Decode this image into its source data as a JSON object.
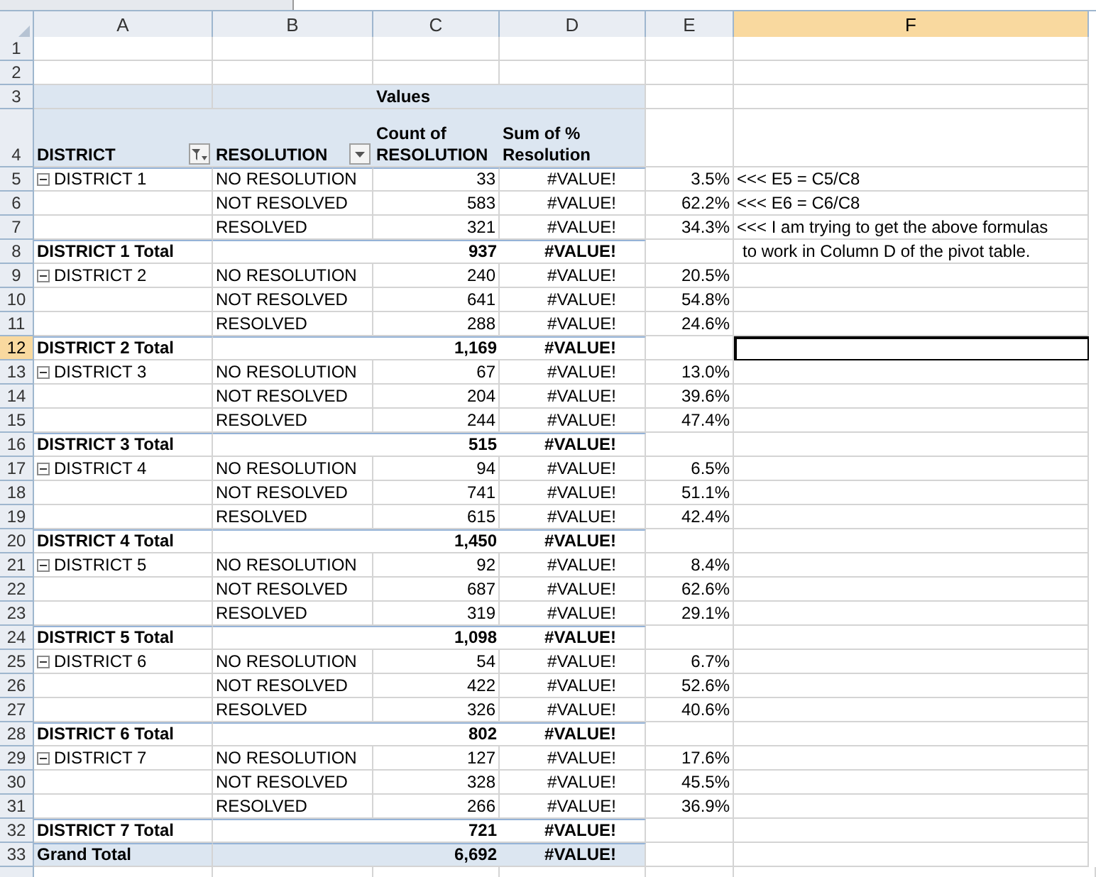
{
  "columns": [
    {
      "label": "A",
      "selected": false
    },
    {
      "label": "B",
      "selected": false
    },
    {
      "label": "C",
      "selected": false
    },
    {
      "label": "D",
      "selected": false
    },
    {
      "label": "E",
      "selected": false
    },
    {
      "label": "F",
      "selected": true
    }
  ],
  "rows": [
    {
      "number": "1",
      "selected": false,
      "kind": "blank"
    },
    {
      "number": "2",
      "selected": false,
      "kind": "blank"
    },
    {
      "number": "3",
      "selected": false,
      "kind": "values_header",
      "c": "Values"
    },
    {
      "number": "4",
      "selected": false,
      "kind": "field_header",
      "a": "DISTRICT",
      "a_filtered": true,
      "b": "RESOLUTION",
      "b_filtered": false,
      "c": "Count of RESOLUTION",
      "d": "Sum of % Resolution"
    },
    {
      "number": "5",
      "selected": false,
      "kind": "item",
      "a": "DISTRICT 1",
      "expanded": true,
      "b": "NO RESOLUTION",
      "c": "33",
      "d": "#VALUE!",
      "e": "3.5%",
      "f": "<<< E5 = C5/C8"
    },
    {
      "number": "6",
      "selected": false,
      "kind": "item",
      "b": "NOT RESOLVED",
      "c": "583",
      "d": "#VALUE!",
      "e": "62.2%",
      "f": "<<< E6 = C6/C8"
    },
    {
      "number": "7",
      "selected": false,
      "kind": "item",
      "b": "RESOLVED",
      "c": "321",
      "d": "#VALUE!",
      "e": "34.3%",
      "f": "<<< I am trying to get the above formulas"
    },
    {
      "number": "8",
      "selected": false,
      "kind": "total",
      "a": "DISTRICT 1 Total",
      "c": "937",
      "d": "#VALUE!",
      "f": "to work in Column D of the pivot table."
    },
    {
      "number": "9",
      "selected": false,
      "kind": "item",
      "a": "DISTRICT 2",
      "expanded": true,
      "b": "NO RESOLUTION",
      "c": "240",
      "d": "#VALUE!",
      "e": "20.5%"
    },
    {
      "number": "10",
      "selected": false,
      "kind": "item",
      "b": "NOT RESOLVED",
      "c": "641",
      "d": "#VALUE!",
      "e": "54.8%"
    },
    {
      "number": "11",
      "selected": false,
      "kind": "item",
      "b": "RESOLVED",
      "c": "288",
      "d": "#VALUE!",
      "e": "24.6%"
    },
    {
      "number": "12",
      "selected": true,
      "kind": "total",
      "a": "DISTRICT 2 Total",
      "c": "1,169",
      "d": "#VALUE!"
    },
    {
      "number": "13",
      "selected": false,
      "kind": "item",
      "a": "DISTRICT 3",
      "expanded": true,
      "b": "NO RESOLUTION",
      "c": "67",
      "d": "#VALUE!",
      "e": "13.0%"
    },
    {
      "number": "14",
      "selected": false,
      "kind": "item",
      "b": "NOT RESOLVED",
      "c": "204",
      "d": "#VALUE!",
      "e": "39.6%"
    },
    {
      "number": "15",
      "selected": false,
      "kind": "item",
      "b": "RESOLVED",
      "c": "244",
      "d": "#VALUE!",
      "e": "47.4%"
    },
    {
      "number": "16",
      "selected": false,
      "kind": "total",
      "a": "DISTRICT 3 Total",
      "c": "515",
      "d": "#VALUE!"
    },
    {
      "number": "17",
      "selected": false,
      "kind": "item",
      "a": "DISTRICT 4",
      "expanded": true,
      "b": "NO RESOLUTION",
      "c": "94",
      "d": "#VALUE!",
      "e": "6.5%"
    },
    {
      "number": "18",
      "selected": false,
      "kind": "item",
      "b": "NOT RESOLVED",
      "c": "741",
      "d": "#VALUE!",
      "e": "51.1%"
    },
    {
      "number": "19",
      "selected": false,
      "kind": "item",
      "b": "RESOLVED",
      "c": "615",
      "d": "#VALUE!",
      "e": "42.4%"
    },
    {
      "number": "20",
      "selected": false,
      "kind": "total",
      "a": "DISTRICT 4 Total",
      "c": "1,450",
      "d": "#VALUE!"
    },
    {
      "number": "21",
      "selected": false,
      "kind": "item",
      "a": "DISTRICT 5",
      "expanded": true,
      "b": "NO RESOLUTION",
      "c": "92",
      "d": "#VALUE!",
      "e": "8.4%"
    },
    {
      "number": "22",
      "selected": false,
      "kind": "item",
      "b": "NOT RESOLVED",
      "c": "687",
      "d": "#VALUE!",
      "e": "62.6%"
    },
    {
      "number": "23",
      "selected": false,
      "kind": "item",
      "b": "RESOLVED",
      "c": "319",
      "d": "#VALUE!",
      "e": "29.1%"
    },
    {
      "number": "24",
      "selected": false,
      "kind": "total",
      "a": "DISTRICT 5 Total",
      "c": "1,098",
      "d": "#VALUE!"
    },
    {
      "number": "25",
      "selected": false,
      "kind": "item",
      "a": "DISTRICT 6",
      "expanded": true,
      "b": "NO RESOLUTION",
      "c": "54",
      "d": "#VALUE!",
      "e": "6.7%"
    },
    {
      "number": "26",
      "selected": false,
      "kind": "item",
      "b": "NOT RESOLVED",
      "c": "422",
      "d": "#VALUE!",
      "e": "52.6%"
    },
    {
      "number": "27",
      "selected": false,
      "kind": "item",
      "b": "RESOLVED",
      "c": "326",
      "d": "#VALUE!",
      "e": "40.6%"
    },
    {
      "number": "28",
      "selected": false,
      "kind": "total",
      "a": "DISTRICT 6 Total",
      "c": "802",
      "d": "#VALUE!"
    },
    {
      "number": "29",
      "selected": false,
      "kind": "item",
      "a": "DISTRICT 7",
      "expanded": true,
      "b": "NO RESOLUTION",
      "c": "127",
      "d": "#VALUE!",
      "e": "17.6%"
    },
    {
      "number": "30",
      "selected": false,
      "kind": "item",
      "b": "NOT RESOLVED",
      "c": "328",
      "d": "#VALUE!",
      "e": "45.5%"
    },
    {
      "number": "31",
      "selected": false,
      "kind": "item",
      "b": "RESOLVED",
      "c": "266",
      "d": "#VALUE!",
      "e": "36.9%"
    },
    {
      "number": "32",
      "selected": false,
      "kind": "total",
      "a": "DISTRICT 7 Total",
      "c": "721",
      "d": "#VALUE!"
    },
    {
      "number": "33",
      "selected": false,
      "kind": "grand_total",
      "a": "Grand Total",
      "c": "6,692",
      "d": "#VALUE!"
    }
  ]
}
